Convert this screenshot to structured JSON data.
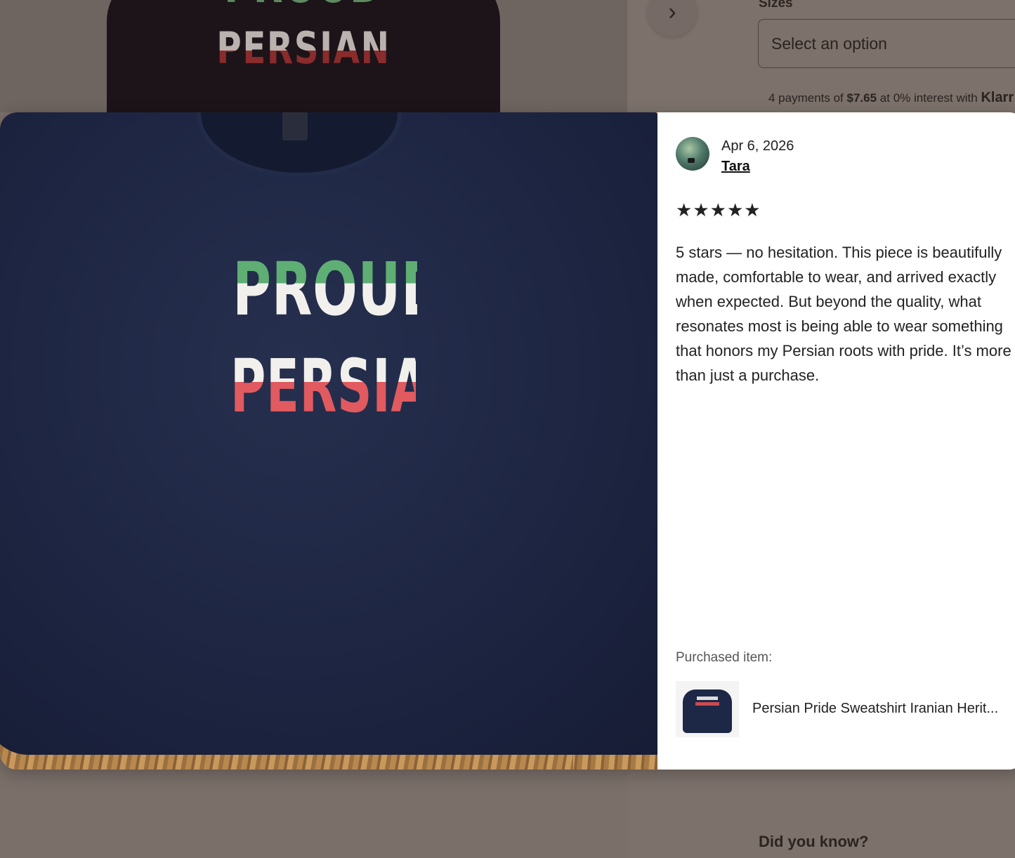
{
  "background": {
    "product_image_text": {
      "line1": "PROUD",
      "line2": "PERSIAN"
    },
    "next_button_icon": "chevron-right-icon",
    "sizes_label": "Sizes",
    "size_select": {
      "value": "Select an option"
    },
    "klarna": {
      "prefix": "4 payments of",
      "amount": "$7.65",
      "suffix": "at 0% interest with",
      "brand": "Klarr"
    },
    "did_you_know": "Did you know?"
  },
  "review_modal": {
    "photo_print": {
      "line1": "PROUD",
      "line2": "PERSIAN"
    },
    "date": "Apr 6, 2026",
    "reviewer": "Tara",
    "rating": 5,
    "stars": [
      "★",
      "★",
      "★",
      "★",
      "★"
    ],
    "text": "5 stars — no hesitation. This piece is beautifully made, comfortable to wear, and arrived exactly when expected. But beyond the quality, what resonates most is being able to wear something that honors my Persian roots with pride. It’s more than just a purchase.",
    "purchased_label": "Purchased item:",
    "purchased_item_title": "Persian Pride Sweatshirt Iranian Herit..."
  }
}
